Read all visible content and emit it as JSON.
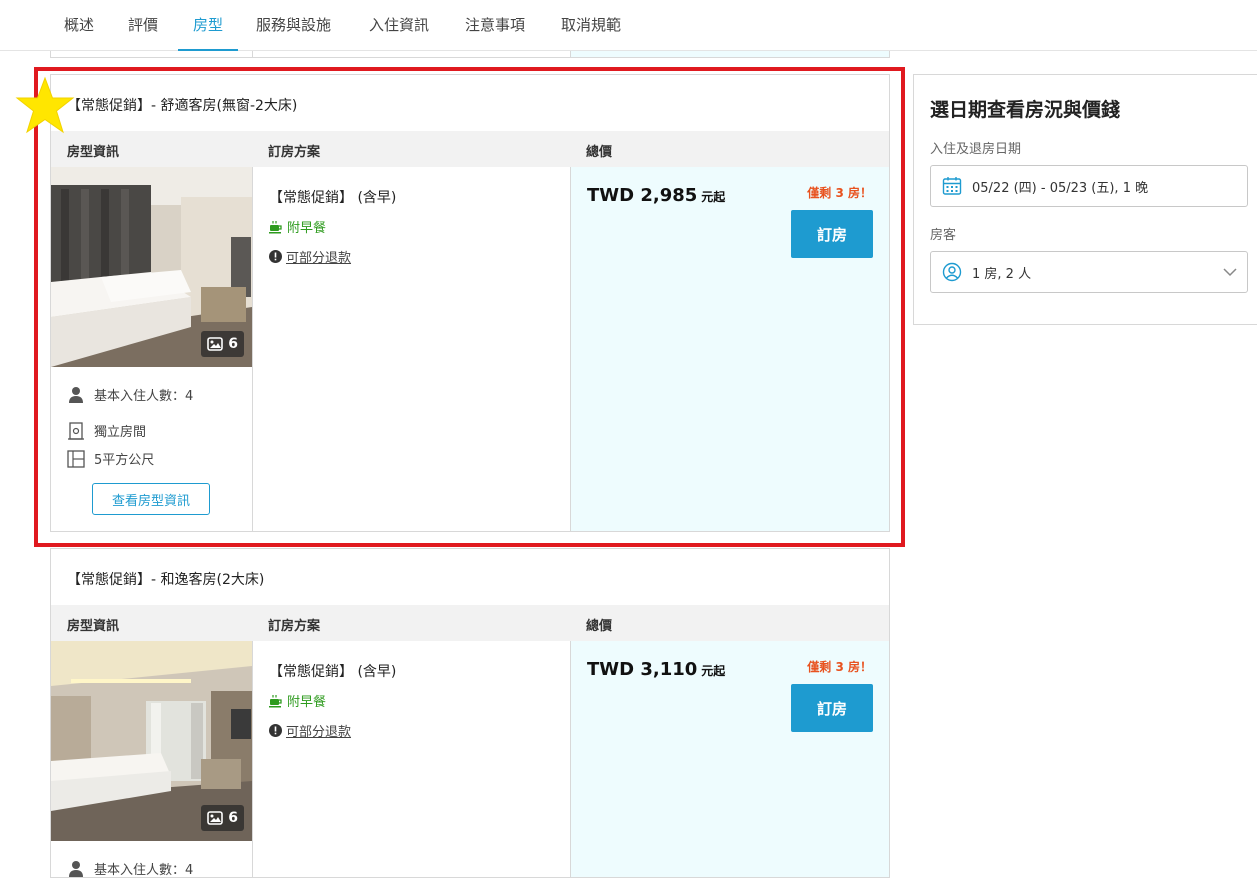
{
  "nav": {
    "tabs": [
      "概述",
      "評價",
      "房型",
      "服務與設施",
      "入住資訊",
      "注意事項",
      "取消規範"
    ],
    "active_index": 2
  },
  "table_headers": {
    "room_info": "房型資訊",
    "plan": "訂房方案",
    "total": "總價"
  },
  "rooms": [
    {
      "title": "【常態促銷】- 舒適客房(無窗-2大床)",
      "photo_count": "6",
      "features": {
        "occupancy": "基本入住人數：4",
        "room_type": "獨立房間",
        "size": "5平方公尺"
      },
      "info_button": "查看房型資訊",
      "plan": {
        "name": "【常態促銷】 (含早)",
        "breakfast": "附早餐",
        "refund": "可部分退款"
      },
      "price": "TWD 2,985",
      "price_suffix": "元起",
      "remaining": "僅剩 3 房！",
      "book_label": "訂房"
    },
    {
      "title": "【常態促銷】- 和逸客房(2大床)",
      "photo_count": "6",
      "features": {
        "occupancy": "基本入住人數：4"
      },
      "plan": {
        "name": "【常態促銷】 (含早)",
        "breakfast": "附早餐",
        "refund": "可部分退款"
      },
      "price": "TWD 3,110",
      "price_suffix": "元起",
      "remaining": "僅剩 3 房！",
      "book_label": "訂房"
    }
  ],
  "sidebar": {
    "title": "選日期查看房況與價錢",
    "date_label": "入住及退房日期",
    "date_value": "05/22 (四) - 05/23 (五), 1 晚",
    "guest_label": "房客",
    "guest_value": "1 房, 2 人"
  },
  "colors": {
    "accent": "#1e9bd0",
    "highlight": "#e0191f",
    "remain": "#e8521f",
    "breakfast": "#2e9b1e",
    "price_bg": "#eefcfe"
  }
}
